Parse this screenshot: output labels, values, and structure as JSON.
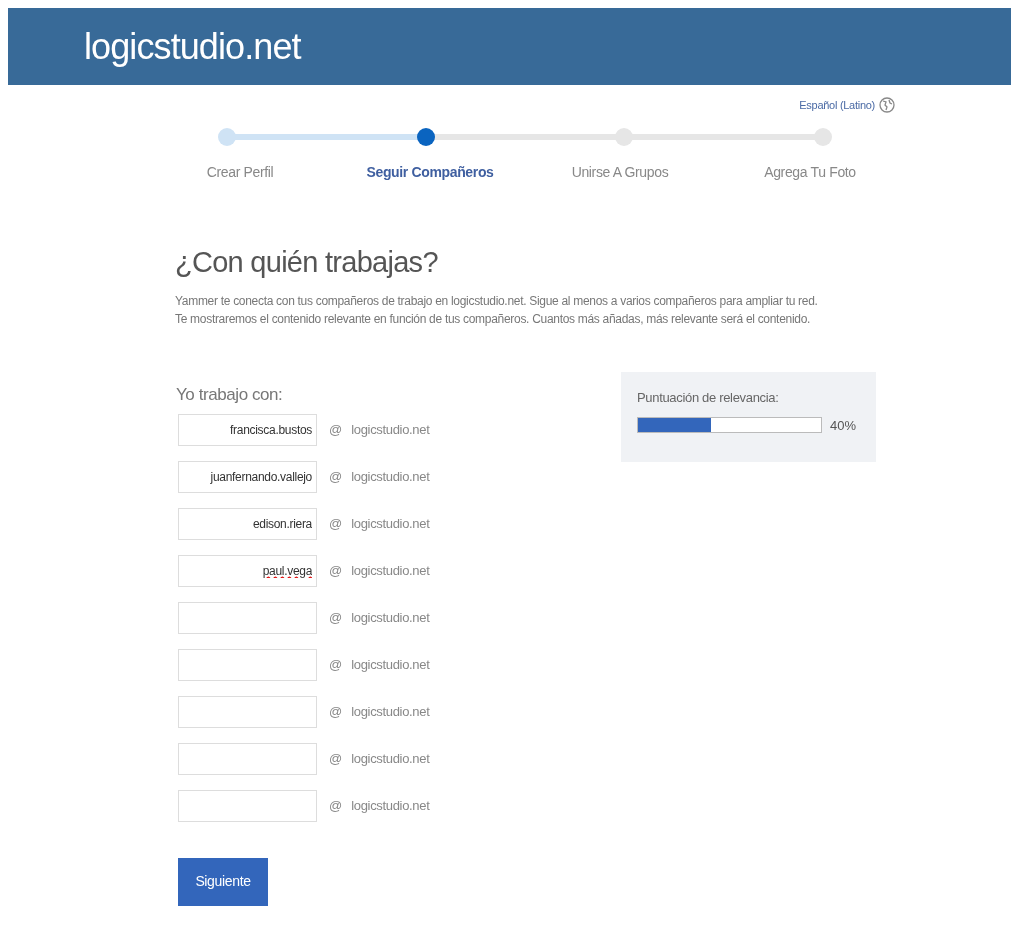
{
  "header": {
    "title": "logicstudio.net"
  },
  "language": {
    "label": "Español (Latino)"
  },
  "steps": [
    {
      "label": "Crear Perfil",
      "done": true,
      "selected": false
    },
    {
      "label": "Seguir Compañeros",
      "done": false,
      "selected": true
    },
    {
      "label": "Unirse A Grupos",
      "done": false,
      "selected": false
    },
    {
      "label": "Agrega Tu Foto",
      "done": false,
      "selected": false
    }
  ],
  "heading": "¿Con quién trabajas?",
  "intro": [
    "Yammer te conecta con tus compañeros de trabajo en logicstudio.net. Sigue al menos a varios compañeros para ampliar tu red.",
    "Te mostraremos el contenido relevante en función de tus compañeros. Cuantos más añadas, más relevante será el contenido."
  ],
  "form": {
    "label": "Yo trabajo con:",
    "rows": [
      {
        "value": "francisca.bustos",
        "misspelled": false,
        "at": "@",
        "domain": "logicstudio.net"
      },
      {
        "value": "juanfernando.vallejo",
        "misspelled": false,
        "at": "@",
        "domain": "logicstudio.net"
      },
      {
        "value": "edison.riera",
        "misspelled": false,
        "at": "@",
        "domain": "logicstudio.net"
      },
      {
        "value": "paul.vega",
        "misspelled": true,
        "at": "@",
        "domain": "logicstudio.net"
      },
      {
        "at": "@",
        "domain": "logicstudio.net"
      },
      {
        "at": "@",
        "domain": "logicstudio.net"
      },
      {
        "at": "@",
        "domain": "logicstudio.net"
      },
      {
        "at": "@",
        "domain": "logicstudio.net"
      },
      {
        "at": "@",
        "domain": "logicstudio.net"
      }
    ]
  },
  "relevance": {
    "label": "Puntuación de relevancia:",
    "level": 0.4,
    "reading": "40%"
  },
  "next_button": "Siguiente"
}
